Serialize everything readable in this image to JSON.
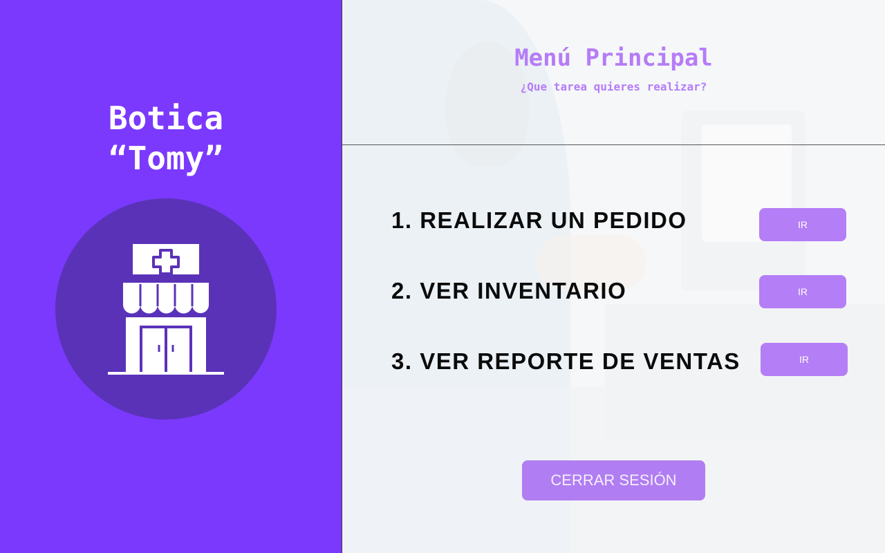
{
  "brand": {
    "line1": "Botica",
    "line2": "“Tomy”",
    "logo_icon": "pharmacy-store-icon"
  },
  "menu": {
    "title": "Menú Principal",
    "subtitle": "¿Que tarea quieres realizar?"
  },
  "options": [
    {
      "label": "1. REALIZAR UN PEDIDO",
      "button": "IR"
    },
    {
      "label": "2. VER INVENTARIO",
      "button": "IR"
    },
    {
      "label": "3. VER REPORTE DE VENTAS",
      "button": "IR"
    }
  ],
  "logout": {
    "label": "CERRAR SESIÓN"
  },
  "colors": {
    "left_panel": "#7b39fd",
    "logo_circle": "#5a32b8",
    "accent": "#b47ef6",
    "title_text": "#b57cf7"
  }
}
